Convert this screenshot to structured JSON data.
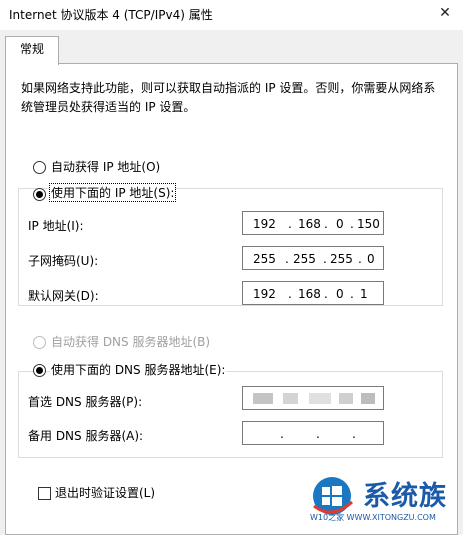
{
  "window": {
    "title": "Internet 协议版本 4 (TCP/IPv4) 属性",
    "close_glyph": "✕"
  },
  "tabs": [
    {
      "label": "常规"
    }
  ],
  "description": "如果网络支持此功能，则可以获取自动指派的 IP 设置。否则，你需要从网络系统管理员处获得适当的 IP 设置。",
  "ip_mode": {
    "auto_label": "自动获得 IP 地址(O)",
    "manual_label": "使用下面的 IP 地址(S):",
    "selected": "manual"
  },
  "ip_fields": {
    "ip_address": {
      "label": "IP 地址(I):",
      "octets": [
        "192",
        "168",
        "0",
        "150"
      ]
    },
    "subnet_mask": {
      "label": "子网掩码(U):",
      "octets": [
        "255",
        "255",
        "255",
        "0"
      ]
    },
    "gateway": {
      "label": "默认网关(D):",
      "octets": [
        "192",
        "168",
        "0",
        "1"
      ]
    }
  },
  "dns_mode": {
    "auto_label": "自动获得 DNS 服务器地址(B)",
    "manual_label": "使用下面的 DNS 服务器地址(E):",
    "selected": "manual"
  },
  "dns_fields": {
    "preferred": {
      "label": "首选 DNS 服务器(P):",
      "octets": [
        "",
        "",
        "",
        ""
      ],
      "obscured": true
    },
    "alternate": {
      "label": "备用 DNS 服务器(A):",
      "octets": [
        "",
        "",
        "",
        ""
      ]
    }
  },
  "validate": {
    "label": "退出时验证设置(L)",
    "checked": false
  },
  "watermark": {
    "brand": "系统族",
    "site": "W10之家 WWW.XITONGZU.COM",
    "colors": [
      "#1a78c2",
      "#e23b2e"
    ]
  }
}
